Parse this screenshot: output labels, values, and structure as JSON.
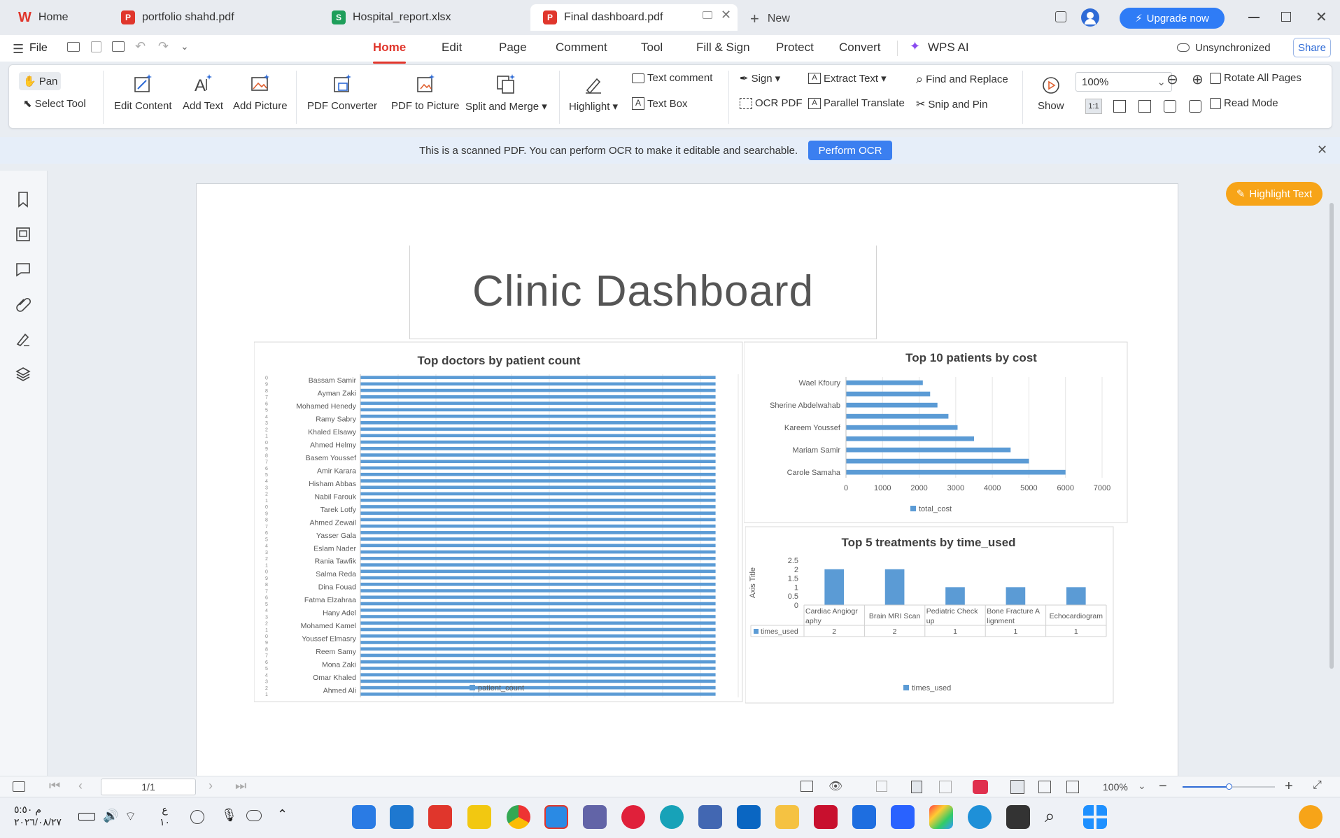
{
  "tabs": [
    {
      "label": "Home",
      "badge": "W",
      "color": "#e0362c"
    },
    {
      "label": "portfolio shahd.pdf",
      "badge": "P",
      "color": "#e0362c"
    },
    {
      "label": "Hospital_report.xlsx",
      "badge": "S",
      "color": "#1e9e5a"
    },
    {
      "label": "Final dashboard.pdf",
      "badge": "P",
      "color": "#e0362c"
    }
  ],
  "new_tab_label": "New",
  "upgrade_label": "Upgrade now",
  "menu": {
    "file": "File",
    "tabs": [
      "Home",
      "Edit",
      "Page",
      "Comment",
      "Tool",
      "Fill & Sign",
      "Protect",
      "Convert",
      "WPS AI"
    ],
    "active_tab": "Home",
    "sync_status": "Unsynchronized",
    "share": "Share"
  },
  "ribbon": {
    "pan": "Pan",
    "select_tool": "Select Tool",
    "edit_content": "Edit Content",
    "add_text": "Add Text",
    "add_picture": "Add Picture",
    "pdf_converter": "PDF Converter",
    "pdf_to_picture": "PDF to Picture",
    "split_merge": "Split and Merge",
    "highlight": "Highlight",
    "text_comment": "Text comment",
    "text_box": "Text Box",
    "sign": "Sign",
    "ocr_pdf": "OCR PDF",
    "extract_text": "Extract Text",
    "parallel_translate": "Parallel Translate",
    "find_replace": "Find and Replace",
    "snip_pin": "Snip and Pin",
    "show": "Show",
    "zoom": "100%",
    "rotate_all": "Rotate All Pages",
    "read_mode": "Read Mode"
  },
  "ocr_banner": {
    "message": "This is a scanned PDF. You can perform OCR to make it editable and searchable.",
    "button": "Perform OCR"
  },
  "highlight_text_btn": "Highlight Text",
  "document": {
    "title": "Clinic Dashboard"
  },
  "chart_data": [
    {
      "type": "bar",
      "orientation": "horizontal",
      "title": "Top doctors by patient count",
      "categories": [
        "Bassam Samir",
        "Ayman Zaki",
        "Mohamed Henedy",
        "Ramy Sabry",
        "Khaled Elsawy",
        "Ahmed Helmy",
        "Basem Youssef",
        "Amir Karara",
        "Hisham Abbas",
        "Nabil Farouk",
        "Tarek Lotfy",
        "Ahmed Zewail",
        "Yasser Gala",
        "Eslam Nader",
        "Rania Tawfik",
        "Salma Reda",
        "Dina Fouad",
        "Fatma Elzahraa",
        "Hany Adel",
        "Mohamed Kamel",
        "Youssef Elmasry",
        "Reem Samy",
        "Mona Zaki",
        "Omar Khaled",
        "Ahmed Ali"
      ],
      "series": [
        {
          "name": "patient_count",
          "values": [
            47,
            47,
            47,
            47,
            47,
            47,
            47,
            47,
            47,
            47,
            47,
            47,
            47,
            47,
            47,
            47,
            47,
            47,
            47,
            47,
            47,
            47,
            47,
            47,
            47
          ]
        }
      ],
      "bar_count": 50,
      "xlim": [
        0,
        50
      ],
      "xticks": [
        0,
        5,
        10,
        15,
        20,
        25,
        30,
        35,
        40,
        45,
        50
      ],
      "color": "#5b9bd5",
      "legend": "bottom"
    },
    {
      "type": "bar",
      "orientation": "horizontal",
      "title": "Top 10 patients by cost",
      "categories": [
        "Wael Kfoury",
        "Sherine Abdelwahab",
        "Kareem Youssef",
        "Mariam Samir",
        "Carole Samaha"
      ],
      "bar_values": [
        2100,
        2300,
        2500,
        2800,
        3050,
        3500,
        4500,
        5000,
        6000
      ],
      "series": [
        {
          "name": "total_cost"
        }
      ],
      "xlim": [
        0,
        7000
      ],
      "xticks": [
        0,
        1000,
        2000,
        3000,
        4000,
        5000,
        6000,
        7000
      ],
      "color": "#5b9bd5",
      "legend": "bottom"
    },
    {
      "type": "bar",
      "title": "Top 5 treatments by time_used",
      "ylabel": "Axis Title",
      "categories": [
        "Cardiac Angiography",
        "Brain MRI Scan",
        "Pediatric Checkup",
        "Bone Fracture Alignment",
        "Echocardiogram"
      ],
      "category_lines": [
        [
          "Cardiac Angiogr",
          "aphy"
        ],
        [
          "Brain MRI Scan"
        ],
        [
          "Pediatric Check",
          "up"
        ],
        [
          "Bone Fracture A",
          "lignment"
        ],
        [
          "Echocardiogram"
        ]
      ],
      "series": [
        {
          "name": "times_used",
          "values": [
            2,
            2,
            1,
            1,
            1
          ]
        }
      ],
      "ylim": [
        0,
        2.5
      ],
      "yticks": [
        0,
        0.5,
        1,
        1.5,
        2,
        2.5
      ],
      "color": "#5b9bd5",
      "legend": "bottom",
      "data_table": true
    }
  ],
  "statusbar": {
    "page": "1/1",
    "zoom": "100%"
  },
  "taskbar": {
    "time": "م ٥:٥٠",
    "date": "٢٠٢٦/٠٨/٢٧",
    "lang": "ع",
    "lang2": "١٠"
  }
}
